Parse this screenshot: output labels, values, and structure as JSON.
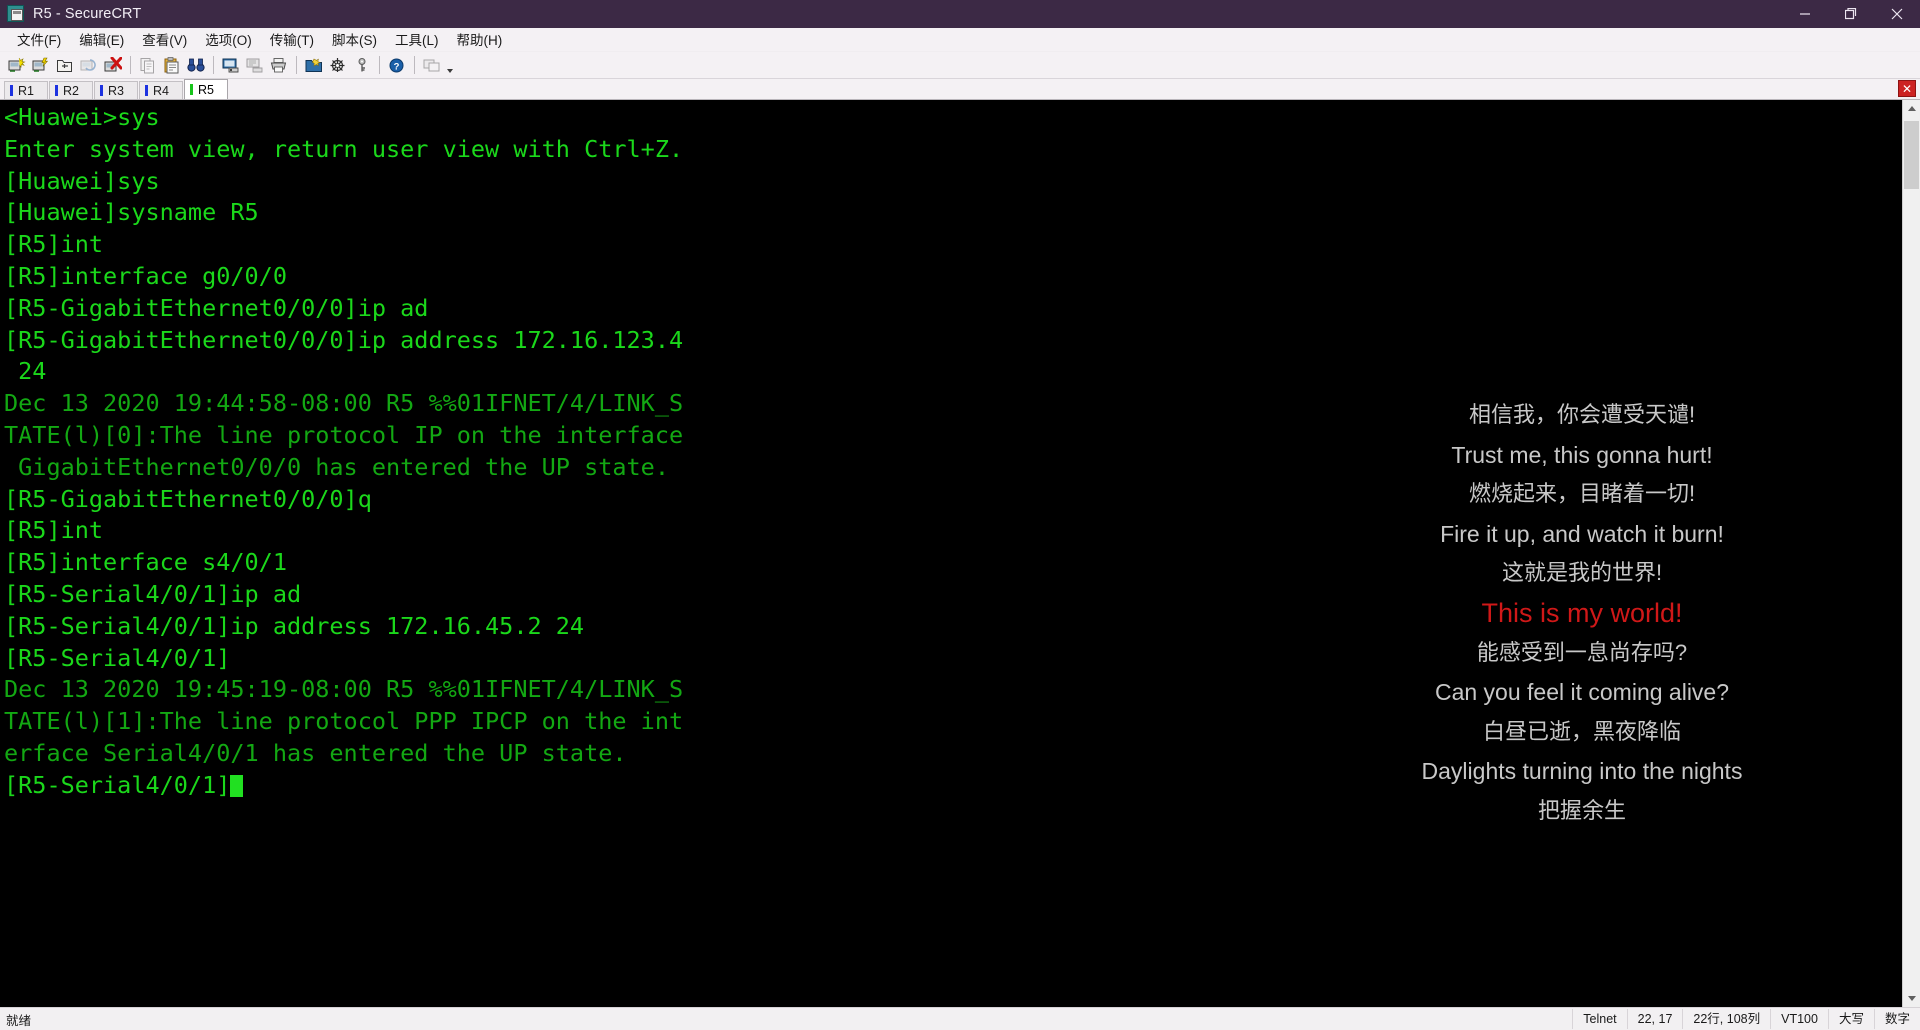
{
  "window": {
    "title": "R5 - SecureCRT",
    "icon": "securecrt-app-icon",
    "minimize_label": "—",
    "maximize_label": "❐",
    "close_label": "✕",
    "titlebar_color": "#3c2945"
  },
  "menubar": {
    "items": [
      {
        "label": "文件(F)",
        "name": "menu-file"
      },
      {
        "label": "编辑(E)",
        "name": "menu-edit"
      },
      {
        "label": "查看(V)",
        "name": "menu-view"
      },
      {
        "label": "选项(O)",
        "name": "menu-options"
      },
      {
        "label": "传输(T)",
        "name": "menu-transfer"
      },
      {
        "label": "脚本(S)",
        "name": "menu-script"
      },
      {
        "label": "工具(L)",
        "name": "menu-tools"
      },
      {
        "label": "帮助(H)",
        "name": "menu-help"
      }
    ]
  },
  "toolbar": {
    "buttons": [
      {
        "name": "new-session-icon",
        "glyph": "new-session"
      },
      {
        "name": "quick-connect-icon",
        "glyph": "quick-connect"
      },
      {
        "name": "connect-in-tab-icon",
        "glyph": "connect-tab"
      },
      {
        "name": "reconnect-icon",
        "glyph": "reconnect"
      },
      {
        "name": "disconnect-icon",
        "glyph": "disconnect"
      },
      {
        "name": "copy-icon",
        "glyph": "copy"
      },
      {
        "name": "paste-icon",
        "glyph": "paste"
      },
      {
        "name": "find-icon",
        "glyph": "binoculars"
      },
      {
        "name": "print-screen-icon",
        "glyph": "print-screen"
      },
      {
        "name": "log-session-icon",
        "glyph": "log-session"
      },
      {
        "name": "print-icon",
        "glyph": "printer"
      },
      {
        "name": "session-options-icon",
        "glyph": "session-options"
      },
      {
        "name": "global-options-icon",
        "glyph": "global-options"
      },
      {
        "name": "key-icon",
        "glyph": "key"
      },
      {
        "name": "help-icon",
        "glyph": "help"
      },
      {
        "name": "arrange-icon",
        "glyph": "arrange"
      }
    ],
    "overflow_label": "▾"
  },
  "tabs": {
    "items": [
      {
        "label": "R1",
        "active": false
      },
      {
        "label": "R2",
        "active": false
      },
      {
        "label": "R3",
        "active": false
      },
      {
        "label": "R4",
        "active": false
      },
      {
        "label": "R5",
        "active": true
      }
    ],
    "close_label": "✕",
    "inactive_tick_color": "#1c32e0",
    "active_tick_color": "#16c31a"
  },
  "terminal": {
    "foreground": "#1bd81b",
    "log_color": "#13a813",
    "background": "#000000",
    "lines": [
      {
        "text": "<Huawei>sys",
        "kind": "cmd"
      },
      {
        "text": "Enter system view, return user view with Ctrl+Z.",
        "kind": "cmd"
      },
      {
        "text": "[Huawei]sys",
        "kind": "cmd"
      },
      {
        "text": "[Huawei]sysname R5",
        "kind": "cmd"
      },
      {
        "text": "[R5]int",
        "kind": "cmd"
      },
      {
        "text": "[R5]interface g0/0/0",
        "kind": "cmd"
      },
      {
        "text": "[R5-GigabitEthernet0/0/0]ip ad",
        "kind": "cmd"
      },
      {
        "text": "[R5-GigabitEthernet0/0/0]ip address 172.16.123.4",
        "kind": "cmd"
      },
      {
        "text": " 24",
        "kind": "cmd"
      },
      {
        "text": "Dec 13 2020 19:44:58-08:00 R5 %%01IFNET/4/LINK_S",
        "kind": "log"
      },
      {
        "text": "TATE(l)[0]:The line protocol IP on the interface",
        "kind": "log"
      },
      {
        "text": " GigabitEthernet0/0/0 has entered the UP state.",
        "kind": "log"
      },
      {
        "text": "[R5-GigabitEthernet0/0/0]q",
        "kind": "cmd"
      },
      {
        "text": "[R5]int",
        "kind": "cmd"
      },
      {
        "text": "[R5]interface s4/0/1",
        "kind": "cmd"
      },
      {
        "text": "[R5-Serial4/0/1]ip ad",
        "kind": "cmd"
      },
      {
        "text": "[R5-Serial4/0/1]ip address 172.16.45.2 24",
        "kind": "cmd"
      },
      {
        "text": "[R5-Serial4/0/1]",
        "kind": "cmd"
      },
      {
        "text": "Dec 13 2020 19:45:19-08:00 R5 %%01IFNET/4/LINK_S",
        "kind": "log"
      },
      {
        "text": "TATE(l)[1]:The line protocol PPP IPCP on the int",
        "kind": "log"
      },
      {
        "text": "erface Serial4/0/1 has entered the UP state.",
        "kind": "log"
      },
      {
        "text": "[R5-Serial4/0/1]",
        "kind": "cmd",
        "cursor": true
      }
    ]
  },
  "lyrics": {
    "normal_color": "#c8c8c8",
    "highlight_color": "#d01818",
    "lines": [
      {
        "text": "相信我，你会遭受天谴!",
        "lang": "cn",
        "highlight": false
      },
      {
        "text": "Trust me, this gonna hurt!",
        "lang": "en",
        "highlight": false
      },
      {
        "text": "燃烧起来，目睹着一切!",
        "lang": "cn",
        "highlight": false
      },
      {
        "text": "Fire it up, and watch it burn!",
        "lang": "en",
        "highlight": false
      },
      {
        "text": "这就是我的世界!",
        "lang": "cn",
        "highlight": false
      },
      {
        "text": "This is my world!",
        "lang": "en",
        "highlight": true
      },
      {
        "text": "能感受到一息尚存吗?",
        "lang": "cn",
        "highlight": false
      },
      {
        "text": "Can you feel it coming alive?",
        "lang": "en",
        "highlight": false
      },
      {
        "text": "白昼已逝，黑夜降临",
        "lang": "cn",
        "highlight": false
      },
      {
        "text": "Daylights turning into the nights",
        "lang": "en",
        "highlight": false
      },
      {
        "text": "把握余生",
        "lang": "cn",
        "highlight": false
      }
    ]
  },
  "statusbar": {
    "ready": "就绪",
    "protocol": "Telnet",
    "cursor_pos": "22, 17",
    "dimensions": "22行, 108列",
    "emulation": "VT100",
    "caps": "大写",
    "num": "数字"
  }
}
